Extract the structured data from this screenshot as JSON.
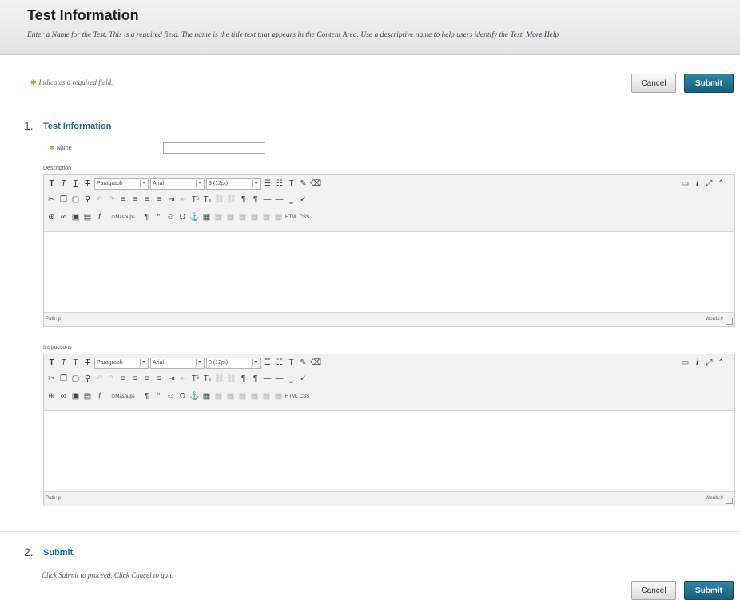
{
  "header": {
    "title": "Test Information",
    "help_text": "Enter a Name for the Test. This is a required field. The name is the title text that appears in the Content Area. Use a descriptive name to help users identify the Test.",
    "more_help": "More Help"
  },
  "required_note": "Indicates a required field.",
  "buttons": {
    "cancel": "Cancel",
    "submit": "Submit"
  },
  "section1": {
    "number": "1.",
    "title": "Test Information"
  },
  "name_field": {
    "label": "Name",
    "value": ""
  },
  "description": {
    "label": "Description"
  },
  "instructions": {
    "label": "Instructions"
  },
  "editor": {
    "format_select": "Paragraph",
    "font_select": "Arial",
    "size_select": "3 (12pt)",
    "mashups": "Mashups",
    "html_label": "HTML CSS",
    "path_label": "Path: p",
    "words_label": "Words:0"
  },
  "section2": {
    "number": "2.",
    "title": "Submit"
  },
  "submit_note": "Click Submit to proceed. Click Cancel to quit.",
  "colors": {
    "accent": "#1f6b99",
    "submit_button": "#1a6e8e",
    "required_star": "#e8962a"
  }
}
